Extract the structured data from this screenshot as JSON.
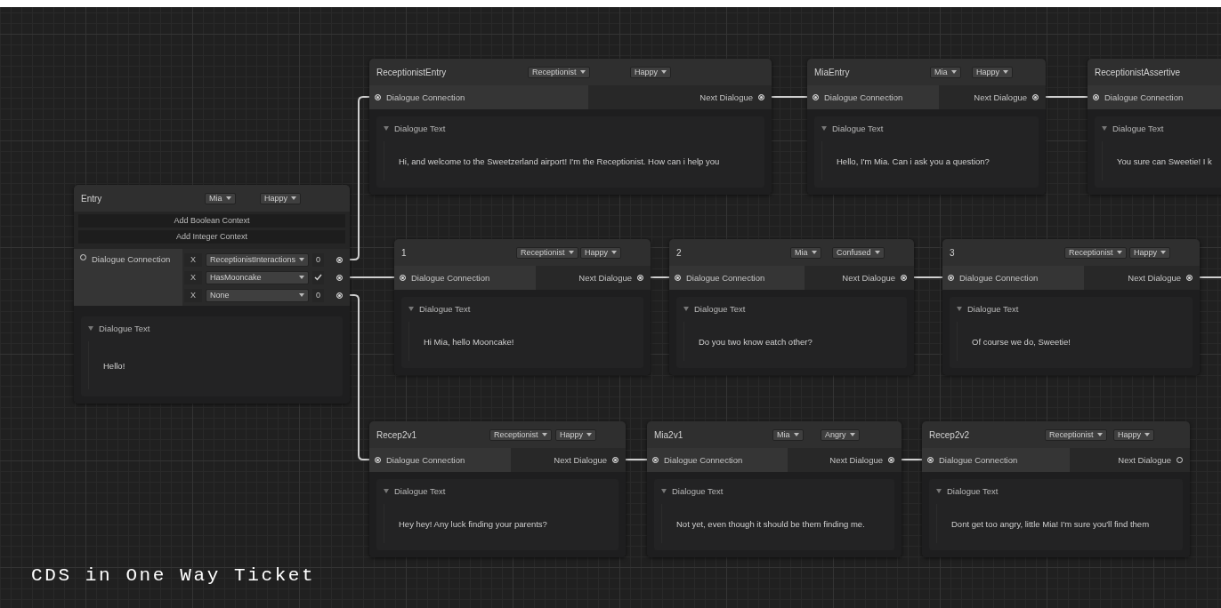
{
  "nodes": [
    {
      "title": "Entry",
      "kind": "entry",
      "character": "Mia",
      "emotion": "Happy",
      "buttons": [
        "Add Boolean Context",
        "Add Integer Context"
      ],
      "input": {
        "label": "Dialogue Connection",
        "connected": false
      },
      "conditions": [
        {
          "remove": "X",
          "context": "ReceptionistInteractions",
          "kind": "integer",
          "value": "0",
          "connected": true
        },
        {
          "remove": "X",
          "context": "HasMooncake",
          "kind": "boolean",
          "checked": true,
          "connected": true
        },
        {
          "remove": "X",
          "context": "None",
          "kind": "integer",
          "value": "0",
          "connected": true
        }
      ],
      "section": "Dialogue Text",
      "text": "Hello!"
    },
    {
      "title": "ReceptionistEntry",
      "kind": "dialogue",
      "character": "Receptionist",
      "emotion": "Happy",
      "input": {
        "label": "Dialogue Connection",
        "connected": true
      },
      "output": {
        "label": "Next Dialogue",
        "connected": true
      },
      "section": "Dialogue Text",
      "text": "Hi, and welcome to the Sweetzerland airport! I'm the Receptionist. How can i help you"
    },
    {
      "title": "MiaEntry",
      "kind": "dialogue",
      "character": "Mia",
      "emotion": "Happy",
      "input": {
        "label": "Dialogue Connection",
        "connected": true
      },
      "output": {
        "label": "Next Dialogue",
        "connected": true
      },
      "section": "Dialogue Text",
      "text": "Hello, I'm Mia. Can i ask you a question?"
    },
    {
      "title": "ReceptionistAssertive",
      "kind": "dialogue",
      "input": {
        "label": "Dialogue Connection",
        "connected": true
      },
      "section": "Dialogue Text",
      "text": "You sure can Sweetie! I k"
    },
    {
      "title": "1",
      "kind": "dialogue",
      "character": "Receptionist",
      "emotion": "Happy",
      "input": {
        "label": "Dialogue Connection",
        "connected": true
      },
      "output": {
        "label": "Next Dialogue",
        "connected": true
      },
      "section": "Dialogue Text",
      "text": "Hi Mia, hello Mooncake!"
    },
    {
      "title": "2",
      "kind": "dialogue",
      "character": "Mia",
      "emotion": "Confused",
      "input": {
        "label": "Dialogue Connection",
        "connected": true
      },
      "output": {
        "label": "Next Dialogue",
        "connected": true
      },
      "section": "Dialogue Text",
      "text": "Do you two know eatch other?"
    },
    {
      "title": "3",
      "kind": "dialogue",
      "character": "Receptionist",
      "emotion": "Happy",
      "input": {
        "label": "Dialogue Connection",
        "connected": true
      },
      "output": {
        "label": "Next Dialogue",
        "connected": true
      },
      "section": "Dialogue Text",
      "text": "Of course we do, Sweetie!"
    },
    {
      "title": "Recep2v1",
      "kind": "dialogue",
      "character": "Receptionist",
      "emotion": "Happy",
      "input": {
        "label": "Dialogue Connection",
        "connected": true
      },
      "output": {
        "label": "Next Dialogue",
        "connected": true
      },
      "section": "Dialogue Text",
      "text": "Hey hey! Any luck finding your parents?"
    },
    {
      "title": "Mia2v1",
      "kind": "dialogue",
      "character": "Mia",
      "emotion": "Angry",
      "input": {
        "label": "Dialogue Connection",
        "connected": true
      },
      "output": {
        "label": "Next Dialogue",
        "connected": true
      },
      "section": "Dialogue Text",
      "text": "Not yet, even though it should be them finding me."
    },
    {
      "title": "Recep2v2",
      "kind": "dialogue",
      "character": "Receptionist",
      "emotion": "Happy",
      "input": {
        "label": "Dialogue Connection",
        "connected": true
      },
      "output": {
        "label": "Next Dialogue",
        "connected": false
      },
      "section": "Dialogue Text",
      "text": "Dont get too angry, little Mia! I'm sure you'll find them"
    }
  ],
  "caption": "CDS in One Way Ticket"
}
